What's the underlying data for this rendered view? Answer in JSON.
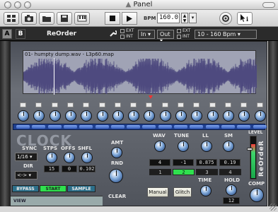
{
  "window": {
    "title": "Panel"
  },
  "toolbar": {
    "bpm_label": "BPM",
    "bpm_value": "160.0"
  },
  "header": {
    "a_label": "A",
    "b_label": "B",
    "patch_name": "ReOrder",
    "ext_label": "EXT",
    "int_label": "INT",
    "in_value": "In",
    "out_value": "Out",
    "range_value": "10 - 160 Bpm"
  },
  "waveform": {
    "filename": "01- humpty dump.wav - L3p60.map"
  },
  "graffiti": {
    "clock": "CLOCK"
  },
  "clock": {
    "sync_label": "SYNC",
    "sync_value": "1/16",
    "dir_label": "DIR",
    "dir_value": "<->",
    "stps_label": "STPS",
    "offs_label": "OFFS",
    "shfl_label": "SHFL",
    "stps_value": "15",
    "offs_value": "0",
    "shfl_value": "0.102"
  },
  "amt_label": "AMT",
  "rnd_label": "RND",
  "clear_label": "CLEAR",
  "bottom": {
    "bypass": "BYPASS",
    "start": "START",
    "sample": "SAMPLE",
    "view": "VIEW"
  },
  "params": {
    "wav_label": "WAV",
    "tune_label": "TUNE",
    "ll_label": "LL",
    "sm_label": "SM",
    "wav_value": "4",
    "tune_value": "-1",
    "ll_value": "0.875",
    "sm_value": "0.19",
    "pages": [
      "1",
      "2",
      "3",
      "4"
    ],
    "active_page": 1
  },
  "buttons": {
    "manual": "Manual",
    "glitch": "Glitch"
  },
  "time": {
    "time_label": "TIME",
    "hold_label": "HOLD",
    "hold_value": "12"
  },
  "comp_label": "COMP",
  "level_label": "LEVEL",
  "brand": "ReOrdeR",
  "colors": {
    "active_green": "#2fe04e",
    "step_blue": "#3b63c0",
    "device_bg": "#5b5f67"
  }
}
